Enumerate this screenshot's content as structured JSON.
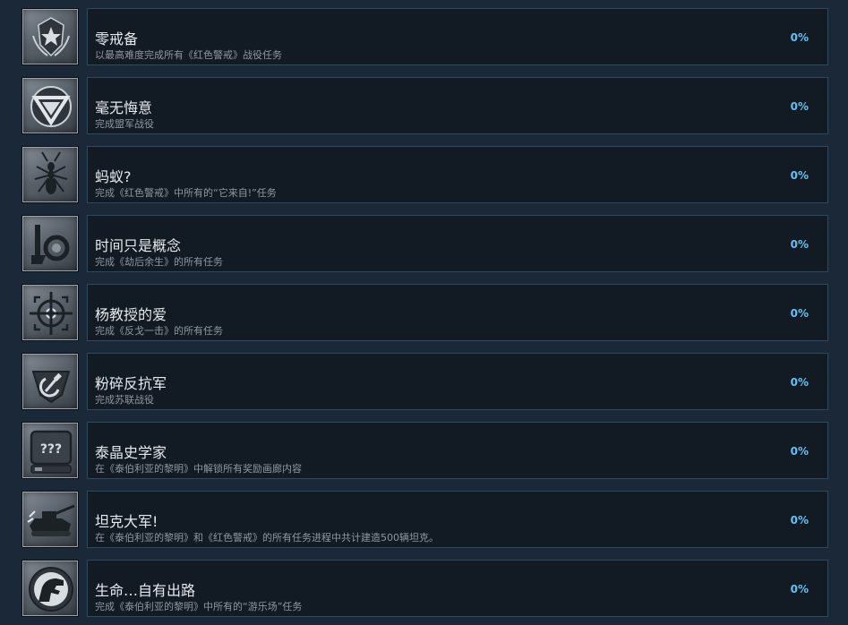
{
  "achievements": [
    {
      "title": "零戒备",
      "description": "以最高难度完成所有《红色警戒》战役任务",
      "percent": "0%",
      "icon": "shield-star-emblem-icon"
    },
    {
      "title": "毫无悔意",
      "description": "完成盟军战役",
      "percent": "0%",
      "icon": "allied-triangle-emblem-icon"
    },
    {
      "title": "蚂蚁?",
      "description": "完成《红色警戒》中所有的“它来自!”任务",
      "percent": "0%",
      "icon": "ant-icon"
    },
    {
      "title": "时间只是概念",
      "description": "完成《劫后余生》的所有任务",
      "percent": "0%",
      "icon": "time-machine-icon"
    },
    {
      "title": "杨教授的爱",
      "description": "完成《反戈一击》的所有任务",
      "percent": "0%",
      "icon": "crosshair-icon"
    },
    {
      "title": "粉碎反抗军",
      "description": "完成苏联战役",
      "percent": "0%",
      "icon": "soviet-hammer-sickle-icon"
    },
    {
      "title": "泰晶史学家",
      "description": "在《泰伯利亚的黎明》中解锁所有奖励画廊内容",
      "percent": "0%",
      "icon": "mystery-box-icon"
    },
    {
      "title": "坦克大军!",
      "description": "在《泰伯利亚的黎明》和《红色警戒》的所有任务进程中共计建造500辆坦克。",
      "percent": "0%",
      "icon": "tank-icon"
    },
    {
      "title": "生命…自有出路",
      "description": "完成《泰伯利亚的黎明》中所有的“游乐场”任务",
      "percent": "0%",
      "icon": "dinosaur-icon"
    }
  ]
}
